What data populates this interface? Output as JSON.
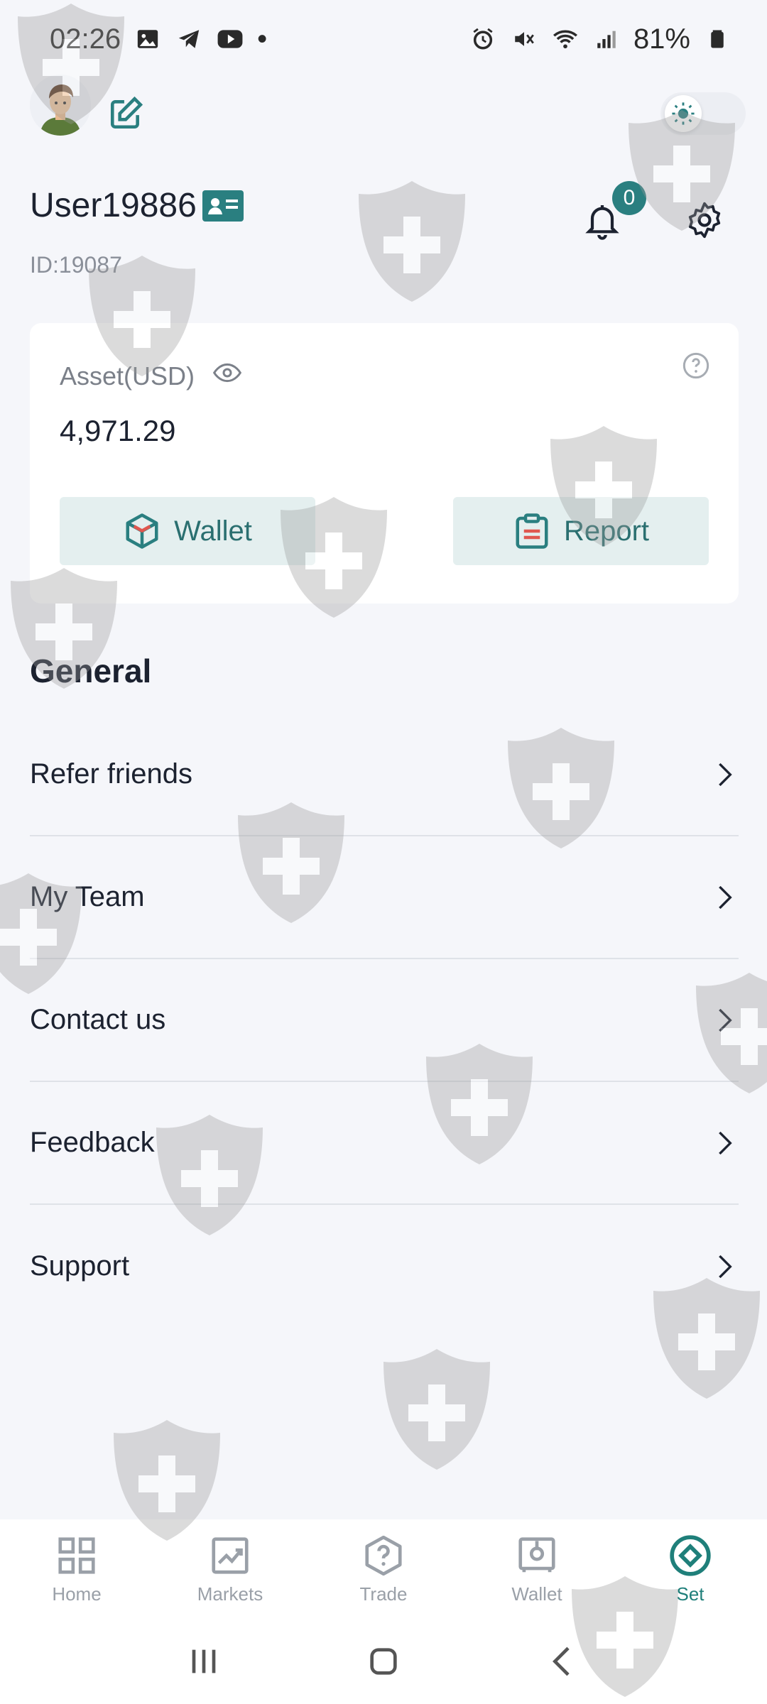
{
  "status_bar": {
    "time": "02:26",
    "dot": "•",
    "battery": "81%",
    "left_icons": [
      "image-icon",
      "telegram-icon",
      "youtube-icon"
    ],
    "right_icons": [
      "alarm-icon",
      "mute-icon",
      "wifi-icon",
      "signal-icon",
      "battery-icon"
    ]
  },
  "header": {
    "username": "User19886",
    "user_id": "ID:19087",
    "notification_count": "0"
  },
  "asset": {
    "label": "Asset(USD)",
    "value": "4,971.29",
    "wallet_label": "Wallet",
    "report_label": "Report"
  },
  "general": {
    "title": "General",
    "items": [
      {
        "label": "Refer friends"
      },
      {
        "label": "My Team"
      },
      {
        "label": "Contact us"
      },
      {
        "label": "Feedback"
      },
      {
        "label": "Support"
      }
    ]
  },
  "bottom_nav": {
    "items": [
      {
        "label": "Home",
        "icon": "grid-icon"
      },
      {
        "label": "Markets",
        "icon": "chart-icon"
      },
      {
        "label": "Trade",
        "icon": "question-icon"
      },
      {
        "label": "Wallet",
        "icon": "safe-icon"
      },
      {
        "label": "Set",
        "icon": "diamond-icon"
      }
    ],
    "active": "Set"
  },
  "colors": {
    "accent": "#2a7f80",
    "background": "#f5f6fa",
    "button_bg": "#e4efef"
  }
}
